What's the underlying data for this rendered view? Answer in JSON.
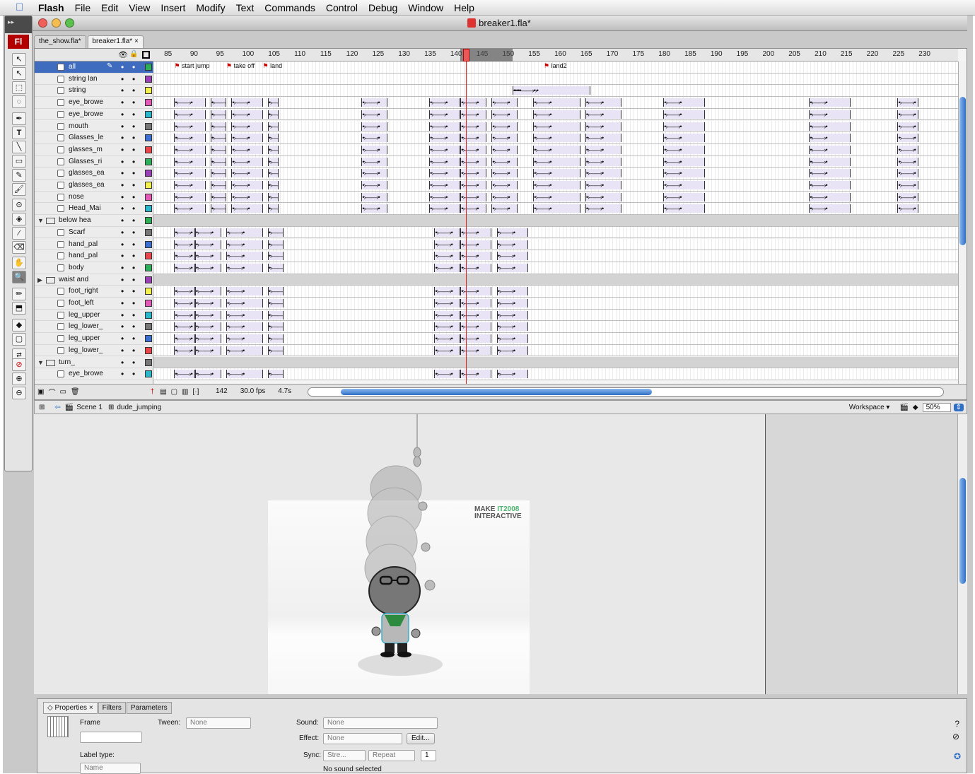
{
  "menubar": {
    "app": "Flash",
    "items": [
      "File",
      "Edit",
      "View",
      "Insert",
      "Modify",
      "Text",
      "Commands",
      "Control",
      "Debug",
      "Window",
      "Help"
    ]
  },
  "window": {
    "title": "breaker1.fla*"
  },
  "tools_panel": {
    "badge": "Fl"
  },
  "doc_tabs": [
    {
      "label": "the_show.fla*"
    },
    {
      "label": "breaker1.fla*"
    }
  ],
  "timeline": {
    "ruler_ticks": [
      "85",
      "90",
      "95",
      "100",
      "105",
      "110",
      "115",
      "120",
      "125",
      "130",
      "135",
      "140",
      "145",
      "150",
      "155",
      "160",
      "165",
      "170",
      "175",
      "180",
      "185",
      "190",
      "195",
      "200",
      "205",
      "210",
      "215",
      "220",
      "225",
      "230"
    ],
    "frame_labels": [
      "start jump",
      "take off",
      "land",
      "land2"
    ],
    "layers": [
      {
        "name": "all",
        "type": "layer",
        "color": "#2fae5a",
        "selected": true
      },
      {
        "name": "string lan",
        "type": "layer",
        "color": "#9b3fb5"
      },
      {
        "name": "string",
        "type": "layer",
        "color": "#f3f050"
      },
      {
        "name": "eye_browe",
        "type": "layer",
        "color": "#e25ab8"
      },
      {
        "name": "eye_browe",
        "type": "layer",
        "color": "#2ab7c9"
      },
      {
        "name": "mouth",
        "type": "layer",
        "color": "#777777"
      },
      {
        "name": "Glasses_le",
        "type": "layer",
        "color": "#3b6fd0"
      },
      {
        "name": "glasses_m",
        "type": "layer",
        "color": "#e8464a"
      },
      {
        "name": "Glasses_ri",
        "type": "layer",
        "color": "#2fae5a"
      },
      {
        "name": "glasses_ea",
        "type": "layer",
        "color": "#9b3fb5"
      },
      {
        "name": "glasses_ea",
        "type": "layer",
        "color": "#f3f050"
      },
      {
        "name": "nose",
        "type": "layer",
        "color": "#e25ab8"
      },
      {
        "name": "Head_Mai",
        "type": "layer",
        "color": "#2ab7c9"
      },
      {
        "name": "below hea",
        "type": "folder-open",
        "color": "#2fae5a"
      },
      {
        "name": "Scarf",
        "type": "layer",
        "color": "#777777"
      },
      {
        "name": "hand_pal",
        "type": "layer",
        "color": "#3b6fd0"
      },
      {
        "name": "hand_pal",
        "type": "layer",
        "color": "#e8464a"
      },
      {
        "name": "body",
        "type": "layer",
        "color": "#2fae5a"
      },
      {
        "name": "waist and",
        "type": "folder-closed",
        "color": "#9b3fb5"
      },
      {
        "name": "foot_right",
        "type": "layer",
        "color": "#f3f050"
      },
      {
        "name": "foot_left",
        "type": "layer",
        "color": "#e25ab8"
      },
      {
        "name": "leg_upper",
        "type": "layer",
        "color": "#2ab7c9"
      },
      {
        "name": "leg_lower_",
        "type": "layer",
        "color": "#777777"
      },
      {
        "name": "leg_upper",
        "type": "layer",
        "color": "#3b6fd0"
      },
      {
        "name": "leg_lower_",
        "type": "layer",
        "color": "#e8464a"
      },
      {
        "name": "turn_",
        "type": "folder-open",
        "color": "#777777"
      },
      {
        "name": "eye_browe",
        "type": "layer",
        "color": "#2ab7c9"
      }
    ],
    "status": {
      "frame": "142",
      "fps": "30.0 fps",
      "time": "4.7s"
    },
    "current_frame": 142
  },
  "edit_bar": {
    "scene": "Scene 1",
    "symbol": "dude_jumping",
    "workspace": "Workspace ▾",
    "zoom": "50%"
  },
  "stage": {
    "brand_line1_a": "MAKE ",
    "brand_line1_b": "IT2008",
    "brand_line2": "INTERACTIVE"
  },
  "properties": {
    "tabs": [
      "Properties",
      "Filters",
      "Parameters"
    ],
    "frame_label": "Frame",
    "frame_value": "",
    "tween_label": "Tween:",
    "tween_value": "None",
    "label_type_label": "Label type:",
    "label_type_value": "Name",
    "sound_label": "Sound:",
    "sound_value": "None",
    "effect_label": "Effect:",
    "effect_value": "None",
    "edit_button": "Edit...",
    "sync_label": "Sync:",
    "sync_value": "Stre...",
    "repeat_value": "Repeat",
    "repeat_count": "1",
    "no_sound": "No sound selected"
  },
  "colors": {
    "playhead": "#e02020",
    "selection": "#3f6cbf",
    "scroll_thumb": "#2f6fc7"
  }
}
